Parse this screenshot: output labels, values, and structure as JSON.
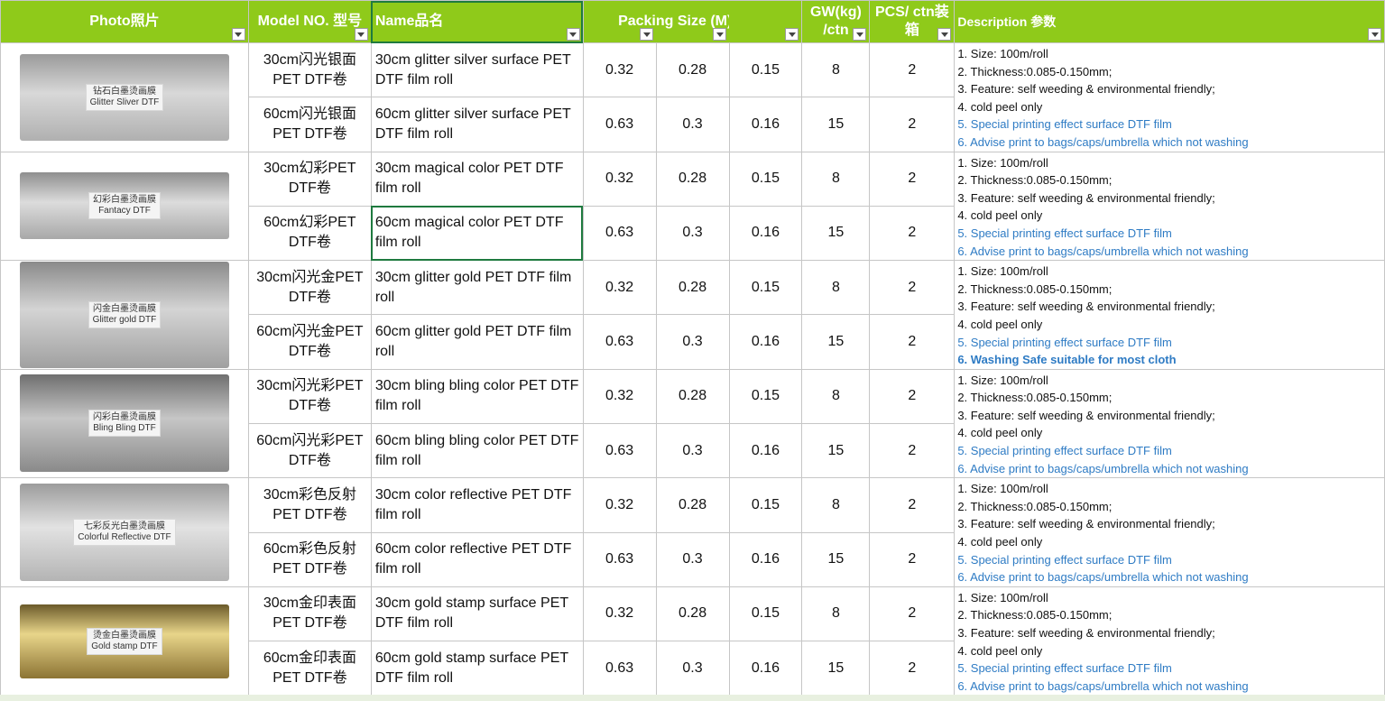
{
  "colors": {
    "header_bg": "#8fca1a",
    "header_text": "#ffffff",
    "link_blue": "#2e7bc4"
  },
  "headers": {
    "photo": "Photo照片",
    "model": "Model NO. 型号",
    "name": "Name品名",
    "packing": "Packing Size (M)打包",
    "gw_1": "GW(kg)",
    "gw_2": "/ctn",
    "pcs_1": "PCS/ ctn装",
    "pcs_2": "箱",
    "desc": "Description 参数"
  },
  "groups": [
    {
      "photo": {
        "label_1": "钻石白墨烫画膜",
        "label_2": "Glitter Sliver DTF",
        "icon": "film-roll-silver"
      },
      "desc": {
        "l1": "1. Size: 100m/roll",
        "l2": "2. Thickness:0.085-0.150mm;",
        "l3": "3. Feature: self weeding & environmental friendly;",
        "l4": "4. cold peel only",
        "l5": "5. Special printing effect surface DTF film",
        "l6": "6. Advise print to bags/caps/umbrella which not washing"
      },
      "rows": [
        {
          "model_1": "30cm闪光银面",
          "model_2": "PET DTF卷",
          "name": "30cm glitter silver surface PET DTF film roll",
          "p1": "0.32",
          "p2": "0.28",
          "p3": "0.15",
          "gw": "8",
          "pcs": "2"
        },
        {
          "model_1": "60cm闪光银面",
          "model_2": "PET DTF卷",
          "name": "60cm glitter silver surface PET DTF film roll",
          "p1": "0.63",
          "p2": "0.3",
          "p3": "0.16",
          "gw": "15",
          "pcs": "2"
        }
      ]
    },
    {
      "photo": {
        "label_1": "幻彩白墨烫画膜",
        "label_2": "Fantacy DTF",
        "icon": "film-roll-fantasy"
      },
      "desc": {
        "l1": "1. Size: 100m/roll",
        "l2": "2. Thickness:0.085-0.150mm;",
        "l3": "3. Feature: self weeding & environmental friendly;",
        "l4": "4. cold peel only",
        "l5": "5. Special printing effect surface DTF film",
        "l6": "6. Advise print to bags/caps/umbrella which not washing"
      },
      "rows": [
        {
          "model_1": "30cm幻彩PET",
          "model_2": "DTF卷",
          "name": "30cm magical color PET DTF film roll",
          "p1": "0.32",
          "p2": "0.28",
          "p3": "0.15",
          "gw": "8",
          "pcs": "2"
        },
        {
          "model_1": "60cm幻彩PET",
          "model_2": "DTF卷",
          "name": "60cm magical color PET DTF film roll",
          "p1": "0.63",
          "p2": "0.3",
          "p3": "0.16",
          "gw": "15",
          "pcs": "2"
        }
      ]
    },
    {
      "photo": {
        "label_1": "闪金白墨烫画膜",
        "label_2": "Glitter gold DTF",
        "icon": "film-roll-gold"
      },
      "desc": {
        "l1": "1. Size: 100m/roll",
        "l2": "2. Thickness:0.085-0.150mm;",
        "l3": "3. Feature: self weeding & environmental friendly;",
        "l4": "4. cold peel only",
        "l5": "5. Special printing effect surface DTF film",
        "l6": "6. Washing Safe suitable for most cloth"
      },
      "rows": [
        {
          "model_1": "30cm闪光金PET",
          "model_2": "DTF卷",
          "name": "30cm glitter gold PET DTF film roll",
          "p1": "0.32",
          "p2": "0.28",
          "p3": "0.15",
          "gw": "8",
          "pcs": "2"
        },
        {
          "model_1": "60cm闪光金PET",
          "model_2": "DTF卷",
          "name": "60cm glitter gold PET DTF film roll",
          "p1": "0.63",
          "p2": "0.3",
          "p3": "0.16",
          "gw": "15",
          "pcs": "2"
        }
      ]
    },
    {
      "photo": {
        "label_1": "闪彩白墨烫画膜",
        "label_2": "Bling Bling DTF",
        "icon": "film-roll-bling"
      },
      "desc": {
        "l1": "1. Size: 100m/roll",
        "l2": "2. Thickness:0.085-0.150mm;",
        "l3": "3. Feature: self weeding & environmental friendly;",
        "l4": "4. cold peel only",
        "l5": "5. Special printing effect surface DTF film",
        "l6": "6. Advise print to bags/caps/umbrella which not washing"
      },
      "rows": [
        {
          "model_1": "30cm闪光彩PET",
          "model_2": "DTF卷",
          "name": "30cm bling bling color PET DTF film roll",
          "p1": "0.32",
          "p2": "0.28",
          "p3": "0.15",
          "gw": "8",
          "pcs": "2"
        },
        {
          "model_1": "60cm闪光彩PET",
          "model_2": "DTF卷",
          "name": "60cm bling bling color PET DTF film roll",
          "p1": "0.63",
          "p2": "0.3",
          "p3": "0.16",
          "gw": "15",
          "pcs": "2"
        }
      ]
    },
    {
      "photo": {
        "label_1": "七彩反光白墨烫画膜",
        "label_2": "Colorful Reflective DTF",
        "icon": "film-roll-reflective"
      },
      "desc": {
        "l1": "1. Size: 100m/roll",
        "l2": "2. Thickness:0.085-0.150mm;",
        "l3": "3. Feature: self weeding & environmental friendly;",
        "l4": "4. cold peel only",
        "l5": "5. Special printing effect surface DTF film",
        "l6": "6. Advise print to bags/caps/umbrella which not washing"
      },
      "rows": [
        {
          "model_1": "30cm彩色反射",
          "model_2": "PET DTF卷",
          "name": "30cm color reflective PET DTF film roll",
          "p1": "0.32",
          "p2": "0.28",
          "p3": "0.15",
          "gw": "8",
          "pcs": "2"
        },
        {
          "model_1": "60cm彩色反射",
          "model_2": "PET DTF卷",
          "name": "60cm color reflective PET DTF film roll",
          "p1": "0.63",
          "p2": "0.3",
          "p3": "0.16",
          "gw": "15",
          "pcs": "2"
        }
      ]
    },
    {
      "photo": {
        "label_1": "烫金白墨烫画膜",
        "label_2": "Gold stamp DTF",
        "icon": "film-roll-gold-stamp"
      },
      "desc": {
        "l1": "1. Size: 100m/roll",
        "l2": "2. Thickness:0.085-0.150mm;",
        "l3": "3. Feature: self weeding & environmental friendly;",
        "l4": "4. cold peel only",
        "l5": "5. Special printing effect surface DTF film",
        "l6": "6. Advise print to bags/caps/umbrella which not washing"
      },
      "rows": [
        {
          "model_1": "30cm金印表面",
          "model_2": "PET DTF卷",
          "name": "30cm gold stamp surface PET DTF film roll",
          "p1": "0.32",
          "p2": "0.28",
          "p3": "0.15",
          "gw": "8",
          "pcs": "2"
        },
        {
          "model_1": "60cm金印表面",
          "model_2": "PET DTF卷",
          "name": "60cm gold stamp surface PET DTF film roll",
          "p1": "0.63",
          "p2": "0.3",
          "p3": "0.16",
          "gw": "15",
          "pcs": "2"
        }
      ]
    }
  ]
}
